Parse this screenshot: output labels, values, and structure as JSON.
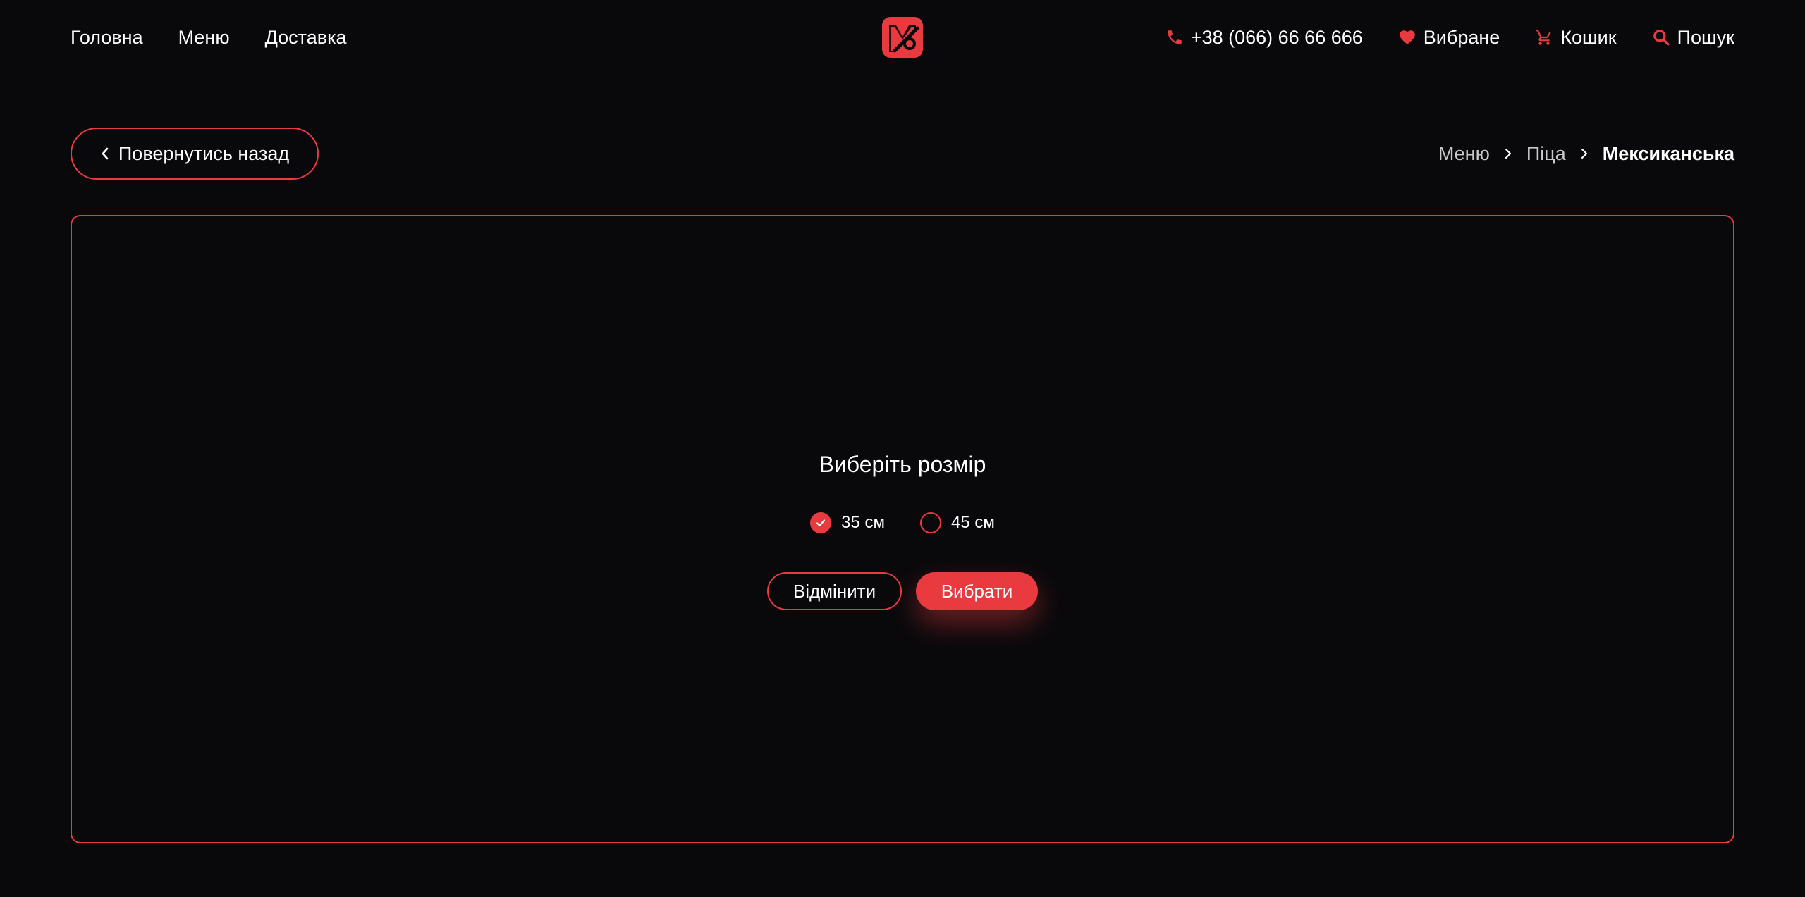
{
  "colors": {
    "background": "#09090c",
    "accent": "#e83a3f",
    "text": "#ffffff",
    "muted_text": "#c9c9cc"
  },
  "header": {
    "nav_left": [
      {
        "label": "Головна"
      },
      {
        "label": "Меню"
      },
      {
        "label": "Доставка"
      }
    ],
    "logo_icon": "brand-logo-icon",
    "phone": {
      "icon": "phone-icon",
      "label": "+38 (066) 66 66 666"
    },
    "favorites": {
      "icon": "heart-icon",
      "label": "Вибране"
    },
    "cart": {
      "icon": "cart-icon",
      "label": "Кошик"
    },
    "search": {
      "icon": "search-icon",
      "label": "Пошук"
    }
  },
  "back": {
    "icon": "chevron-left-icon",
    "label": "Повернутись назад"
  },
  "breadcrumb": [
    {
      "label": "Меню"
    },
    {
      "label": "Піца"
    },
    {
      "label": "Мексиканська"
    }
  ],
  "dialog": {
    "title": "Виберіть розмір",
    "options": [
      {
        "label": "35 см",
        "selected": true
      },
      {
        "label": "45 см",
        "selected": false
      }
    ],
    "cancel_label": "Відмінити",
    "confirm_label": "Вибрати"
  }
}
